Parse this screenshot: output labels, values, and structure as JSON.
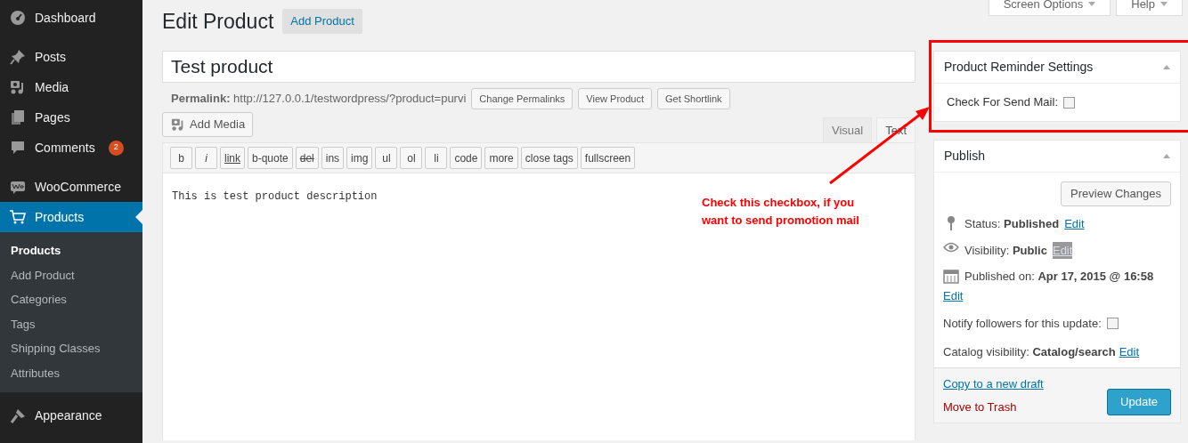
{
  "sidebar": {
    "items": [
      {
        "label": "Dashboard",
        "selected": false
      },
      {
        "label": "Posts",
        "selected": false
      },
      {
        "label": "Media",
        "selected": false
      },
      {
        "label": "Pages",
        "selected": false
      },
      {
        "label": "Comments",
        "badge": "2",
        "selected": false
      },
      {
        "label": "WooCommerce",
        "selected": false
      },
      {
        "label": "Products",
        "selected": true,
        "children": [
          {
            "label": "Products",
            "selected": true
          },
          {
            "label": "Add Product",
            "selected": false
          },
          {
            "label": "Categories",
            "selected": false
          },
          {
            "label": "Tags",
            "selected": false
          },
          {
            "label": "Shipping Classes",
            "selected": false
          },
          {
            "label": "Attributes",
            "selected": false
          }
        ]
      },
      {
        "label": "Appearance",
        "selected": false
      }
    ]
  },
  "screen_meta": [
    "Screen Options",
    "Help"
  ],
  "page_title": "Edit Product",
  "page_title_action": "Add Product",
  "post_title": "Test product",
  "permalink": {
    "label": "Permalink:",
    "url": "http://127.0.0.1/testwordpress/?product=purvi",
    "buttons": [
      "Change Permalinks",
      "View Product",
      "Get Shortlink"
    ]
  },
  "add_media": "Add Media",
  "editor_tabs": [
    {
      "label": "Visual",
      "selected": false
    },
    {
      "label": "Text",
      "selected": true
    }
  ],
  "quicktags": [
    {
      "label": "b",
      "kind": "plain"
    },
    {
      "label": "i",
      "kind": "italic"
    },
    {
      "label": "link",
      "kind": "link"
    },
    {
      "label": "b-quote",
      "kind": "plain"
    },
    {
      "label": "del",
      "kind": "del"
    },
    {
      "label": "ins",
      "kind": "plain"
    },
    {
      "label": "img",
      "kind": "plain"
    },
    {
      "label": "ul",
      "kind": "plain"
    },
    {
      "label": "ol",
      "kind": "plain"
    },
    {
      "label": "li",
      "kind": "plain"
    },
    {
      "label": "code",
      "kind": "plain"
    },
    {
      "label": "more",
      "kind": "plain"
    },
    {
      "label": "close tags",
      "kind": "plain"
    },
    {
      "label": "fullscreen",
      "kind": "plain"
    }
  ],
  "content": "This is test product description",
  "annotation": {
    "lines": [
      "Check this checkbox, if you",
      "want to send promotion mail"
    ]
  },
  "reminder_box": {
    "title": "Product Reminder Settings",
    "field_label": "Check For Send Mail:",
    "checked": false
  },
  "publish": {
    "title": "Publish",
    "preview": "Preview Changes",
    "rows": [
      {
        "label": "Status:",
        "value": "Published",
        "link": "Edit",
        "highlighted": false
      },
      {
        "label": "Visibility:",
        "value": "Public",
        "link": "Edit",
        "highlighted": true
      },
      {
        "label": "Published on:",
        "value": "Apr 17, 2015 @ 16:58",
        "link": "Edit",
        "highlighted": false
      }
    ],
    "notify": {
      "label": "Notify followers for this update:",
      "checked": false
    },
    "catalog": {
      "label": "Catalog visibility:",
      "value": "Catalog/search",
      "link": "Edit"
    },
    "copy_link": "Copy to a new draft",
    "trash": "Move to Trash",
    "update": "Update"
  }
}
